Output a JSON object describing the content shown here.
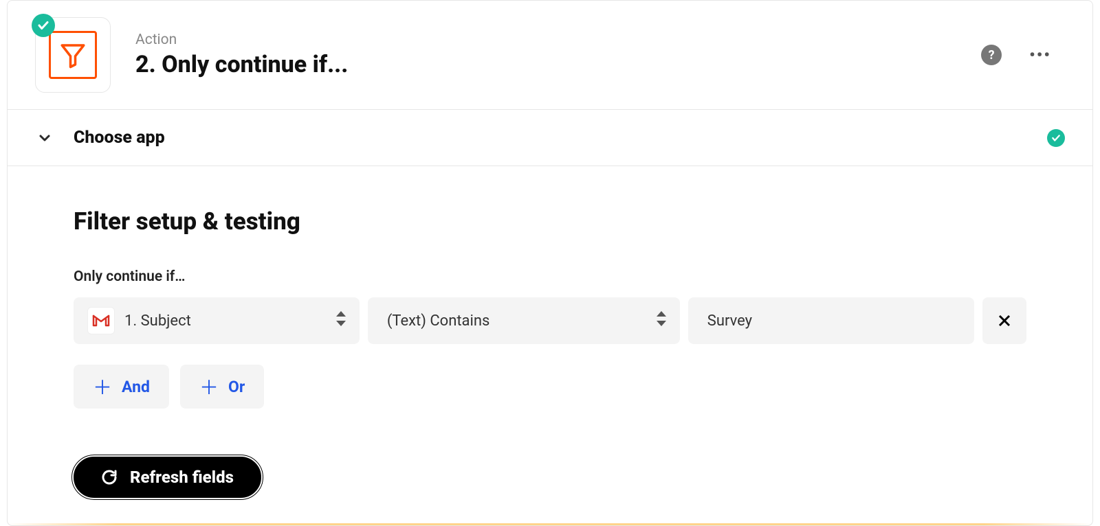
{
  "header": {
    "action_label": "Action",
    "step_title": "2. Only continue if...",
    "help_label": "?",
    "more_label": "•••"
  },
  "choose_app": {
    "label": "Choose app"
  },
  "body": {
    "title": "Filter setup & testing",
    "subtitle": "Only continue if…",
    "field_value": "1. Subject",
    "condition_value": "(Text) Contains",
    "value_value": "Survey",
    "and_label": "And",
    "or_label": "Or",
    "refresh_label": "Refresh fields"
  }
}
